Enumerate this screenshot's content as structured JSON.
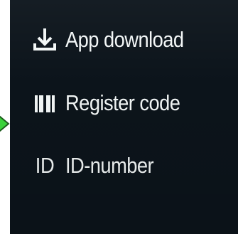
{
  "menu": {
    "items": [
      {
        "label": "App download",
        "icon": "download-icon"
      },
      {
        "label": "Register code",
        "icon": "barcode-icon"
      },
      {
        "label": "ID-number",
        "icon": "id-icon",
        "icon_text": "ID"
      }
    ]
  },
  "colors": {
    "screen_bg": "#0c141b",
    "text": "#f3f7f7",
    "arrow_fill": "#3bd13b",
    "arrow_stroke": "#1c5a1c"
  }
}
